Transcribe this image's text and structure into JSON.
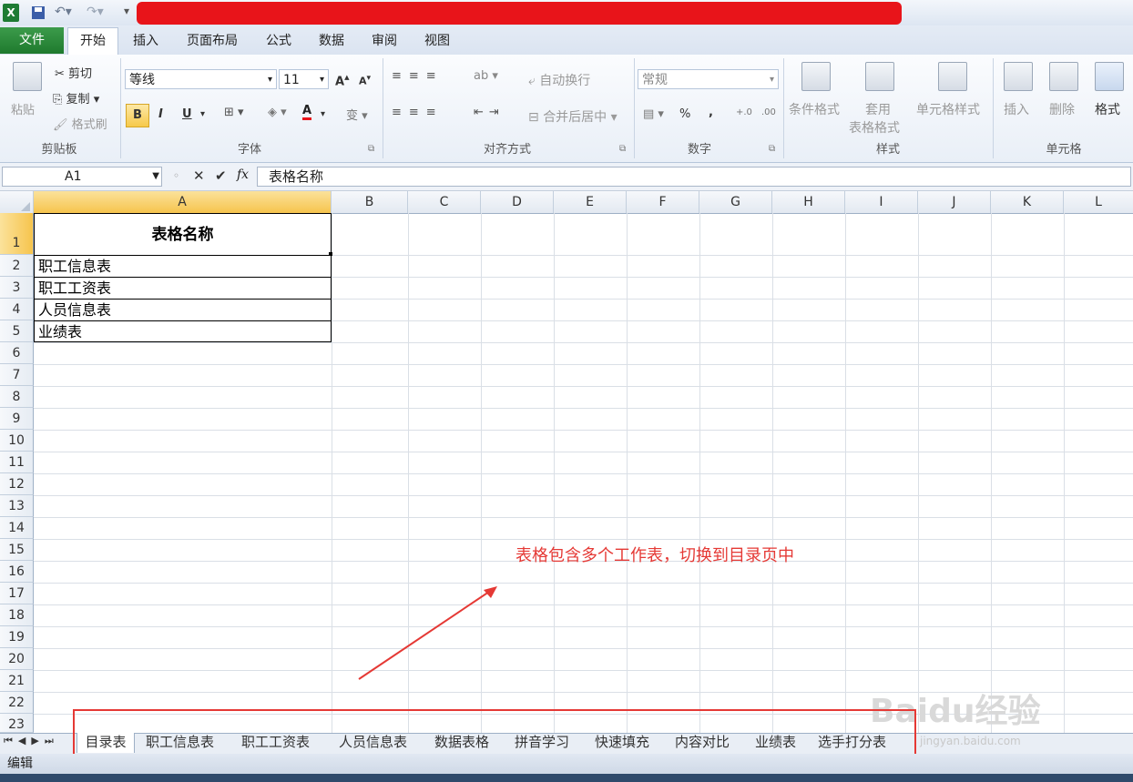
{
  "ribbon_tabs": [
    "文件",
    "开始",
    "插入",
    "页面布局",
    "公式",
    "数据",
    "审阅",
    "视图"
  ],
  "clipboard": {
    "paste": "粘贴",
    "cut": "剪切",
    "copy": "复制",
    "format_painter": "格式刷",
    "label": "剪贴板"
  },
  "font": {
    "name": "等线",
    "size": "11",
    "bold": "B",
    "italic": "I",
    "underline": "U",
    "label": "字体",
    "font_color_letter": "A",
    "wen": "变"
  },
  "alignment": {
    "wrap": "自动换行",
    "merge": "合并后居中",
    "label": "对齐方式"
  },
  "number": {
    "format": "常规",
    "percent": "%",
    "comma": ",",
    "inc_dec": "+.0\n.00",
    "dec_dec": ".00\n+.0",
    "label": "数字"
  },
  "styles": {
    "conditional": "条件格式",
    "table_format_1": "套用",
    "table_format_2": "表格格式",
    "cell_styles": "单元格样式",
    "label": "样式"
  },
  "cells": {
    "insert": "插入",
    "delete": "删除",
    "format": "格式",
    "label": "单元格"
  },
  "formula_bar": {
    "name_box": "A1",
    "fx": "fx",
    "content": "表格名称"
  },
  "columns": [
    "A",
    "B",
    "C",
    "D",
    "E",
    "F",
    "G",
    "H",
    "I",
    "J",
    "K",
    "L"
  ],
  "rows": [
    "1",
    "2",
    "3",
    "4",
    "5",
    "6",
    "7",
    "8",
    "9",
    "10",
    "11",
    "12",
    "13",
    "14",
    "15",
    "16",
    "17",
    "18",
    "19",
    "20",
    "21",
    "22",
    "23"
  ],
  "cells_data": {
    "A1": "表格名称",
    "A2": "职工信息表",
    "A3": "职工工资表",
    "A4": "人员信息表",
    "A5": "业绩表"
  },
  "sheet_tabs": [
    "目录表",
    "职工信息表",
    "职工工资表",
    "人员信息表",
    "数据表格",
    "拼音学习",
    "快速填充",
    "内容对比",
    "业绩表",
    "选手打分表"
  ],
  "status": "编辑",
  "annotation": "表格包含多个工作表，切换到目录页中",
  "watermark": "Baidu经验",
  "watermark_url": "jingyan.baidu.com",
  "colors": {
    "accent_green": "#1f7a2e",
    "annotation_red": "#e53935",
    "redaction": "#e8141a"
  }
}
